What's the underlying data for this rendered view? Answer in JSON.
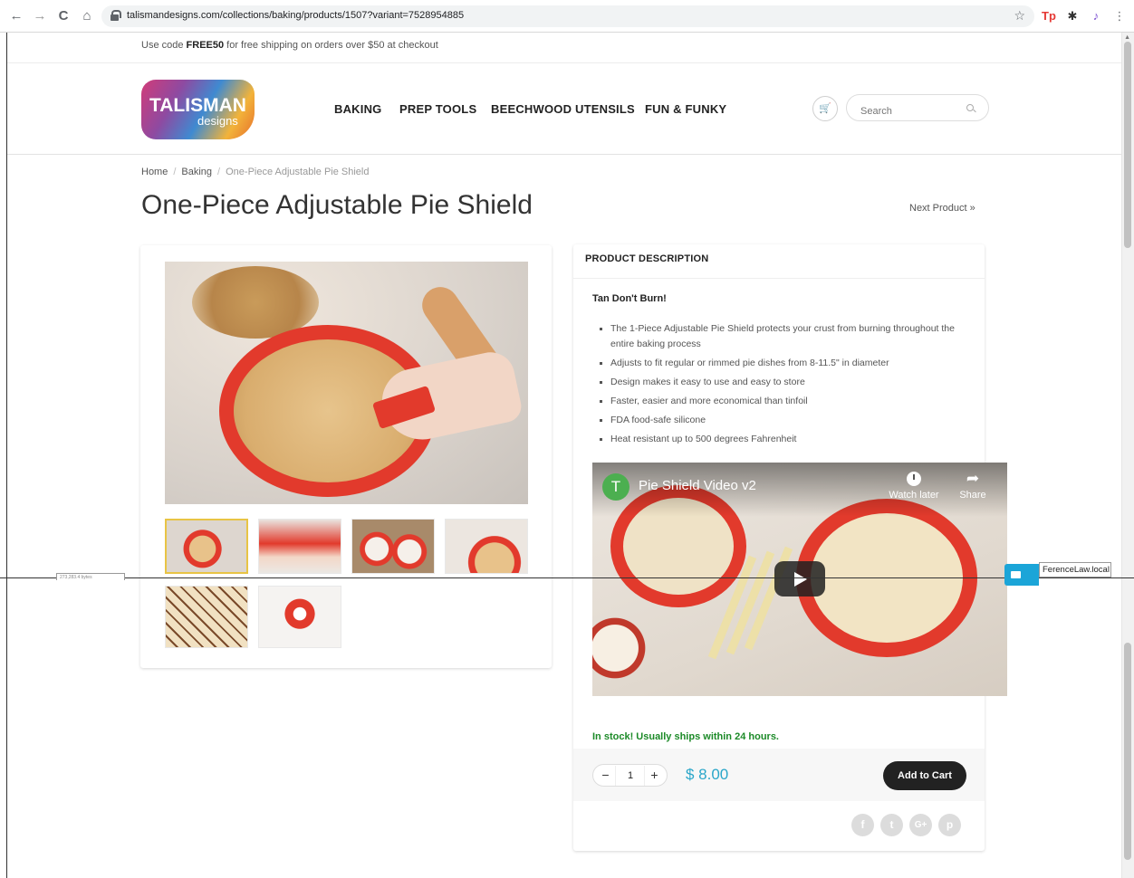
{
  "browser": {
    "url": "talismandesigns.com/collections/baking/products/1507?variant=7528954885",
    "nav": {
      "back": "←",
      "forward": "→",
      "reload": "C",
      "home": "⌂"
    },
    "extensions": [
      "Tp",
      "✱",
      "♪",
      "⋮"
    ],
    "star": "☆"
  },
  "promo": {
    "prefix": "Use code ",
    "code": "FREE50",
    "suffix": " for free shipping on orders over $50 at checkout"
  },
  "logo": {
    "line1": "TALISMAN",
    "line2": "designs"
  },
  "nav": [
    "BAKING",
    "PREP TOOLS",
    "BEECHWOOD UTENSILS",
    "FUN & FUNKY"
  ],
  "search": {
    "placeholder": "Search"
  },
  "breadcrumb": {
    "home": "Home",
    "sep": "/",
    "category": "Baking",
    "current": "One-Piece Adjustable Pie Shield"
  },
  "product": {
    "title": "One-Piece Adjustable Pie Shield",
    "next_label": "Next Product »",
    "description_heading": "PRODUCT DESCRIPTION",
    "tagline": "Tan Don't Burn!",
    "bullets": [
      "The 1-Piece Adjustable Pie Shield protects your crust from burning throughout the entire baking process",
      "Adjusts to fit regular or rimmed pie dishes from 8-11.5\" in diameter",
      "Design makes it easy to use and easy to store",
      "Faster, easier and more economical than tinfoil",
      "FDA food-safe silicone",
      "Heat resistant up to 500 degrees Fahrenheit"
    ],
    "stock": "In stock! Usually ships within 24 hours.",
    "quantity": "1",
    "price": "$ 8.00",
    "add_to_cart": "Add to Cart"
  },
  "video": {
    "channel_initial": "T",
    "title": "Pie Shield Video v2",
    "watch_later": "Watch later",
    "share": "Share"
  },
  "social": [
    "f",
    "t",
    "G+",
    "p"
  ],
  "overlay": {
    "tooltip": "FerenceLaw.local",
    "left_tag": "273,283.4 bytes"
  },
  "colors": {
    "price": "#2aa6c9",
    "stock": "#1c8a28",
    "accent_red": "#e23a2c"
  }
}
